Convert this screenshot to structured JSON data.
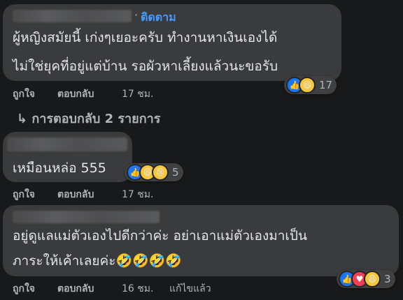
{
  "comments": [
    {
      "follow_label": "ติดตาม",
      "separator": "·",
      "lines": [
        "ผู้หญิงสมัยนี้ เก่งๆเยอะครับ ทำงานหาเงินเองได้",
        "ไม่ใช่ยุคที่อยู่แต่บ้าน รอผัวหาเลี้ยงแล้วนะขอรับ"
      ],
      "like_label": "ถูกใจ",
      "reply_label": "ตอบกลับ",
      "time": "17 ชม.",
      "reactions": [
        "like-icon",
        "haha-icon"
      ],
      "reaction_count": "17"
    },
    {
      "lines": [
        "เหมือนหล่อ 555"
      ],
      "like_label": "ถูกใจ",
      "reply_label": "ตอบกลับ",
      "time": "17 ชม.",
      "reactions": [
        "like-icon",
        "haha-icon",
        "sad-icon"
      ],
      "reaction_count": "5"
    },
    {
      "lines": [
        "อยู่ดูแลแม่ตัวเองไปดีกว่าค่ะ อย่าเอาแม่ตัวเองมาเป็น",
        "ภาระให้เค้าเลยค่ะ🤣🤣🤣🤣"
      ],
      "like_label": "ถูกใจ",
      "reply_label": "ตอบกลับ",
      "time": "16 ชม.",
      "edited_label": "แก้ไขแล้ว",
      "reactions": [
        "like-icon",
        "love-icon",
        "haha-icon"
      ],
      "reaction_count": "3"
    }
  ],
  "view_replies": {
    "arrow": "↳",
    "label": "การตอบกลับ 2 รายการ"
  }
}
